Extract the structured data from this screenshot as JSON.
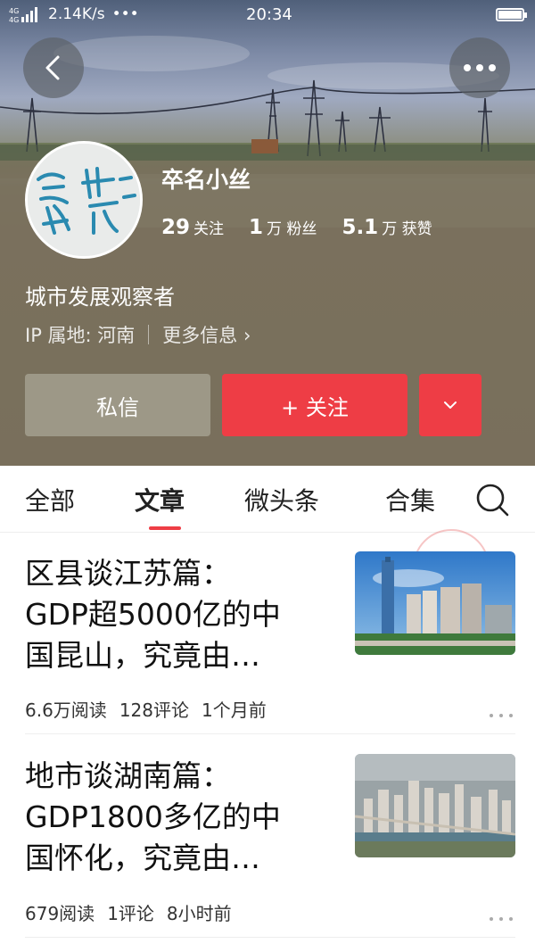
{
  "status_bar": {
    "network": "4G 4G",
    "speed": "2.14K/s",
    "dots": "•••",
    "time": "20:34"
  },
  "profile": {
    "name": "卒名小丝",
    "stats": [
      {
        "num": "29",
        "label": "关注"
      },
      {
        "num": "1",
        "label": "万 粉丝"
      },
      {
        "num": "5.1",
        "label": "万 获赞"
      }
    ],
    "bio": "城市发展观察者",
    "ip_location": "IP 属地: 河南",
    "more_info": "更多信息 ›",
    "message_button": "私信",
    "follow_button": "+ 关注"
  },
  "tabs": [
    {
      "label": "全部"
    },
    {
      "label": "文章"
    },
    {
      "label": "微头条"
    },
    {
      "label": "合集"
    }
  ],
  "articles": [
    {
      "title": "区县谈江苏篇：GDP超5000亿的中国昆山，究竟由…",
      "title_lines": [
        "区县谈江苏篇：",
        "GDP超5000亿的中",
        "国昆山，究竟由…"
      ],
      "reads": "6.6万阅读",
      "comments": "128评论",
      "time": "1个月前"
    },
    {
      "title": "地市谈湖南篇：GDP1800多亿的中国怀化，究竟由…",
      "title_lines": [
        "地市谈湖南篇：",
        "GDP1800多亿的中",
        "国怀化，究竟由…"
      ],
      "reads": "679阅读",
      "comments": "1评论",
      "time": "8小时前"
    }
  ],
  "colors": {
    "accent": "#ee3d45",
    "white": "#ffffff"
  }
}
